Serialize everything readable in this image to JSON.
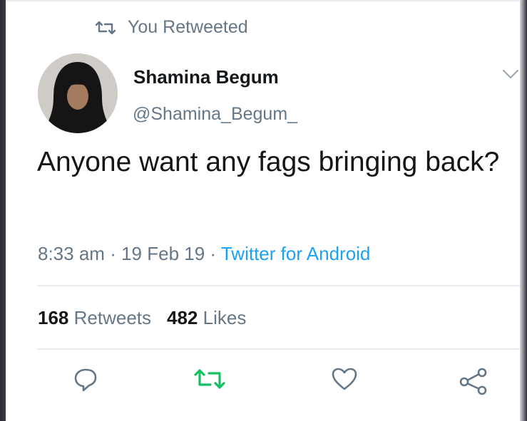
{
  "retweet_banner": {
    "label": "You Retweeted",
    "icon": "retweet-icon"
  },
  "author": {
    "name": "Shamina Begum",
    "handle": "@Shamina_Begum_"
  },
  "tweet": {
    "text": "Anyone want any fags bringing back?",
    "time": "8:33 am",
    "date": "19 Feb 19",
    "separator": "·",
    "source": "Twitter for Android"
  },
  "stats": {
    "retweets_count": "168",
    "retweets_label": "Retweets",
    "likes_count": "482",
    "likes_label": "Likes"
  },
  "actions": [
    {
      "icon": "reply-icon"
    },
    {
      "icon": "retweet-icon",
      "active": true
    },
    {
      "icon": "like-icon"
    },
    {
      "icon": "share-icon"
    }
  ],
  "colors": {
    "text": "#14171a",
    "secondary": "#657786",
    "link": "#1da1f2",
    "retweet_active": "#17bf63",
    "border": "#e6ecf0"
  }
}
